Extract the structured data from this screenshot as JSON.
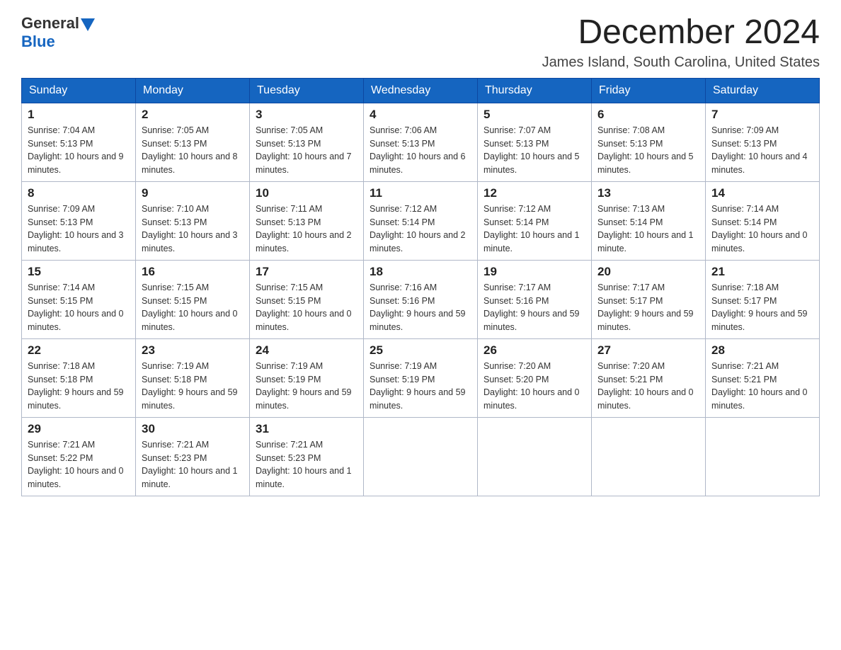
{
  "header": {
    "logo_general": "General",
    "logo_blue": "Blue",
    "month_title": "December 2024",
    "location": "James Island, South Carolina, United States"
  },
  "days_of_week": [
    "Sunday",
    "Monday",
    "Tuesday",
    "Wednesday",
    "Thursday",
    "Friday",
    "Saturday"
  ],
  "weeks": [
    [
      {
        "day": "1",
        "sunrise": "7:04 AM",
        "sunset": "5:13 PM",
        "daylight": "10 hours and 9 minutes."
      },
      {
        "day": "2",
        "sunrise": "7:05 AM",
        "sunset": "5:13 PM",
        "daylight": "10 hours and 8 minutes."
      },
      {
        "day": "3",
        "sunrise": "7:05 AM",
        "sunset": "5:13 PM",
        "daylight": "10 hours and 7 minutes."
      },
      {
        "day": "4",
        "sunrise": "7:06 AM",
        "sunset": "5:13 PM",
        "daylight": "10 hours and 6 minutes."
      },
      {
        "day": "5",
        "sunrise": "7:07 AM",
        "sunset": "5:13 PM",
        "daylight": "10 hours and 5 minutes."
      },
      {
        "day": "6",
        "sunrise": "7:08 AM",
        "sunset": "5:13 PM",
        "daylight": "10 hours and 5 minutes."
      },
      {
        "day": "7",
        "sunrise": "7:09 AM",
        "sunset": "5:13 PM",
        "daylight": "10 hours and 4 minutes."
      }
    ],
    [
      {
        "day": "8",
        "sunrise": "7:09 AM",
        "sunset": "5:13 PM",
        "daylight": "10 hours and 3 minutes."
      },
      {
        "day": "9",
        "sunrise": "7:10 AM",
        "sunset": "5:13 PM",
        "daylight": "10 hours and 3 minutes."
      },
      {
        "day": "10",
        "sunrise": "7:11 AM",
        "sunset": "5:13 PM",
        "daylight": "10 hours and 2 minutes."
      },
      {
        "day": "11",
        "sunrise": "7:12 AM",
        "sunset": "5:14 PM",
        "daylight": "10 hours and 2 minutes."
      },
      {
        "day": "12",
        "sunrise": "7:12 AM",
        "sunset": "5:14 PM",
        "daylight": "10 hours and 1 minute."
      },
      {
        "day": "13",
        "sunrise": "7:13 AM",
        "sunset": "5:14 PM",
        "daylight": "10 hours and 1 minute."
      },
      {
        "day": "14",
        "sunrise": "7:14 AM",
        "sunset": "5:14 PM",
        "daylight": "10 hours and 0 minutes."
      }
    ],
    [
      {
        "day": "15",
        "sunrise": "7:14 AM",
        "sunset": "5:15 PM",
        "daylight": "10 hours and 0 minutes."
      },
      {
        "day": "16",
        "sunrise": "7:15 AM",
        "sunset": "5:15 PM",
        "daylight": "10 hours and 0 minutes."
      },
      {
        "day": "17",
        "sunrise": "7:15 AM",
        "sunset": "5:15 PM",
        "daylight": "10 hours and 0 minutes."
      },
      {
        "day": "18",
        "sunrise": "7:16 AM",
        "sunset": "5:16 PM",
        "daylight": "9 hours and 59 minutes."
      },
      {
        "day": "19",
        "sunrise": "7:17 AM",
        "sunset": "5:16 PM",
        "daylight": "9 hours and 59 minutes."
      },
      {
        "day": "20",
        "sunrise": "7:17 AM",
        "sunset": "5:17 PM",
        "daylight": "9 hours and 59 minutes."
      },
      {
        "day": "21",
        "sunrise": "7:18 AM",
        "sunset": "5:17 PM",
        "daylight": "9 hours and 59 minutes."
      }
    ],
    [
      {
        "day": "22",
        "sunrise": "7:18 AM",
        "sunset": "5:18 PM",
        "daylight": "9 hours and 59 minutes."
      },
      {
        "day": "23",
        "sunrise": "7:19 AM",
        "sunset": "5:18 PM",
        "daylight": "9 hours and 59 minutes."
      },
      {
        "day": "24",
        "sunrise": "7:19 AM",
        "sunset": "5:19 PM",
        "daylight": "9 hours and 59 minutes."
      },
      {
        "day": "25",
        "sunrise": "7:19 AM",
        "sunset": "5:19 PM",
        "daylight": "9 hours and 59 minutes."
      },
      {
        "day": "26",
        "sunrise": "7:20 AM",
        "sunset": "5:20 PM",
        "daylight": "10 hours and 0 minutes."
      },
      {
        "day": "27",
        "sunrise": "7:20 AM",
        "sunset": "5:21 PM",
        "daylight": "10 hours and 0 minutes."
      },
      {
        "day": "28",
        "sunrise": "7:21 AM",
        "sunset": "5:21 PM",
        "daylight": "10 hours and 0 minutes."
      }
    ],
    [
      {
        "day": "29",
        "sunrise": "7:21 AM",
        "sunset": "5:22 PM",
        "daylight": "10 hours and 0 minutes."
      },
      {
        "day": "30",
        "sunrise": "7:21 AM",
        "sunset": "5:23 PM",
        "daylight": "10 hours and 1 minute."
      },
      {
        "day": "31",
        "sunrise": "7:21 AM",
        "sunset": "5:23 PM",
        "daylight": "10 hours and 1 minute."
      },
      null,
      null,
      null,
      null
    ]
  ],
  "labels": {
    "sunrise_prefix": "Sunrise: ",
    "sunset_prefix": "Sunset: ",
    "daylight_prefix": "Daylight: "
  }
}
